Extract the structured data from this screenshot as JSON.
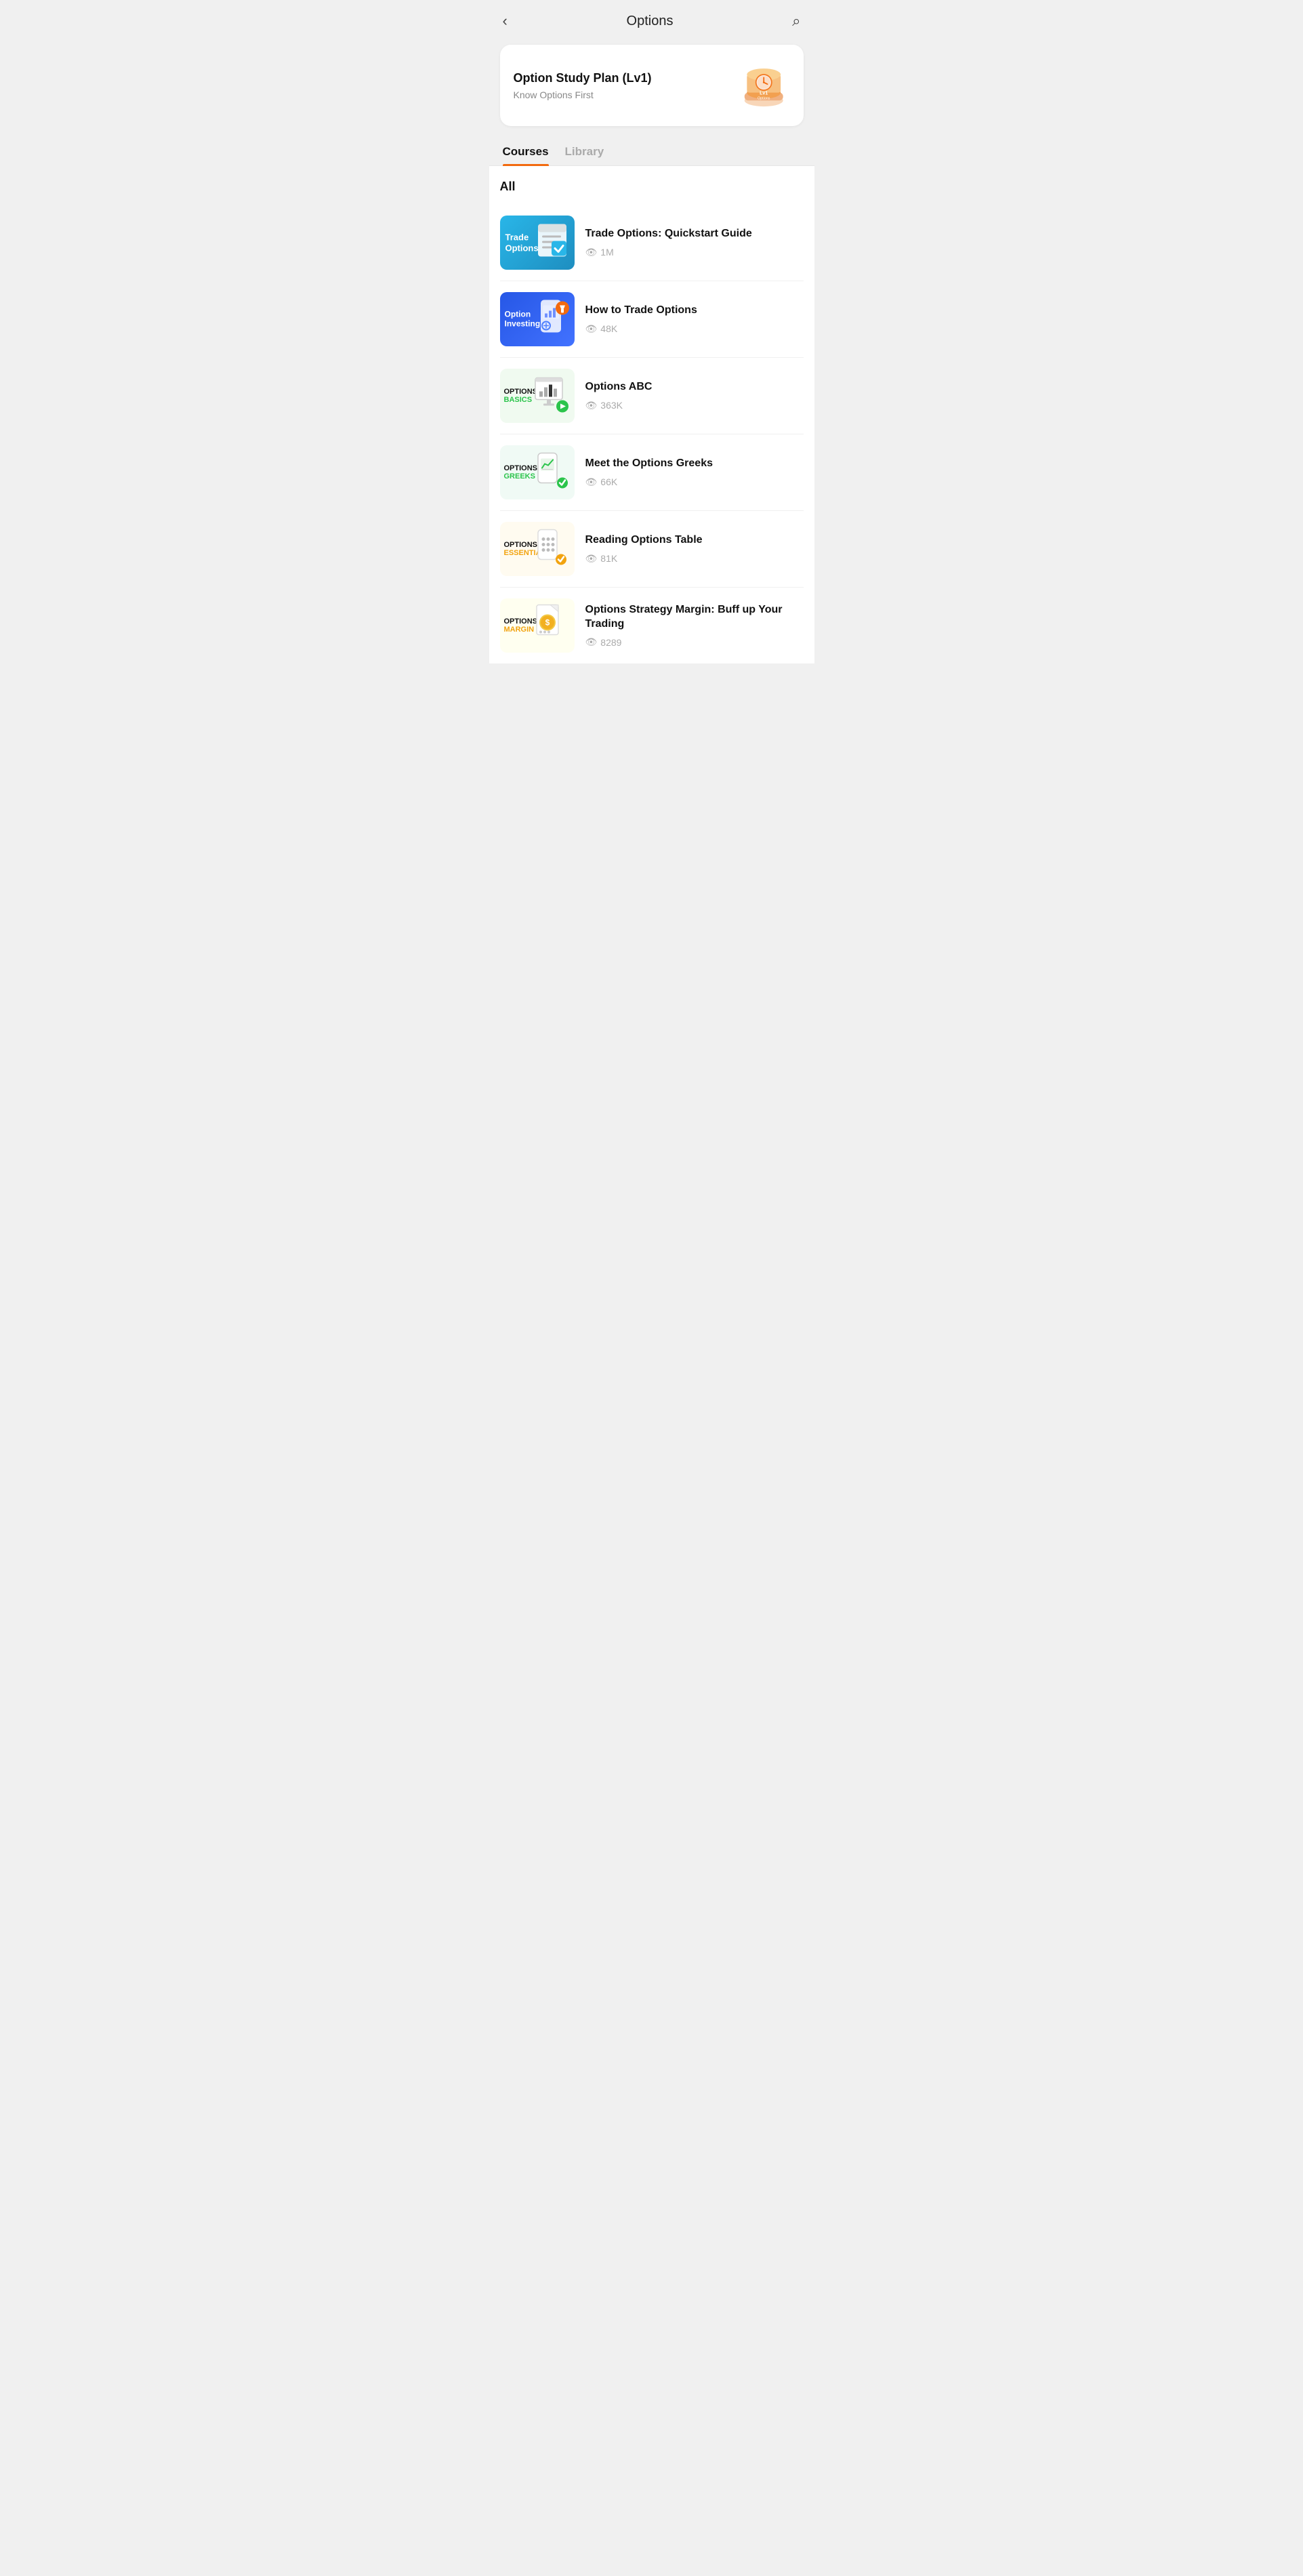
{
  "header": {
    "title": "Options",
    "back_label": "‹",
    "search_label": "⌕"
  },
  "study_plan": {
    "title": "Option Study Plan (Lv1)",
    "subtitle": "Know Options First"
  },
  "tabs": [
    {
      "id": "courses",
      "label": "Courses",
      "active": true
    },
    {
      "id": "library",
      "label": "Library",
      "active": false
    }
  ],
  "section_title": "All",
  "courses": [
    {
      "id": "trade-options",
      "title": "Trade Options: Quickstart Guide",
      "views": "1M",
      "thumb_type": "trade-options",
      "thumb_label_line1": "Trade",
      "thumb_label_line2": "Options"
    },
    {
      "id": "how-to-trade-options",
      "title": "How to Trade Options",
      "views": "48K",
      "thumb_type": "option-investing",
      "thumb_label_line1": "Option",
      "thumb_label_line2": "Investing"
    },
    {
      "id": "options-abc",
      "title": "Options ABC",
      "views": "363K",
      "thumb_type": "options-basics",
      "thumb_label_top": "OPTIONS",
      "thumb_label_bottom": "BASICS"
    },
    {
      "id": "meet-options-greeks",
      "title": "Meet the Options Greeks",
      "views": "66K",
      "thumb_type": "options-greeks",
      "thumb_label_top": "OPTIONS",
      "thumb_label_bottom": "GREEKS"
    },
    {
      "id": "reading-options-table",
      "title": "Reading Options Table",
      "views": "81K",
      "thumb_type": "options-essentials",
      "thumb_label_top": "OPTIONS",
      "thumb_label_bottom": "ESSENTIALS"
    },
    {
      "id": "options-strategy-margin",
      "title": "Options Strategy Margin: Buff up Your Trading",
      "views": "8289",
      "thumb_type": "options-margin",
      "thumb_label_top": "OPTIONS",
      "thumb_label_bottom": "MARGIN"
    }
  ]
}
